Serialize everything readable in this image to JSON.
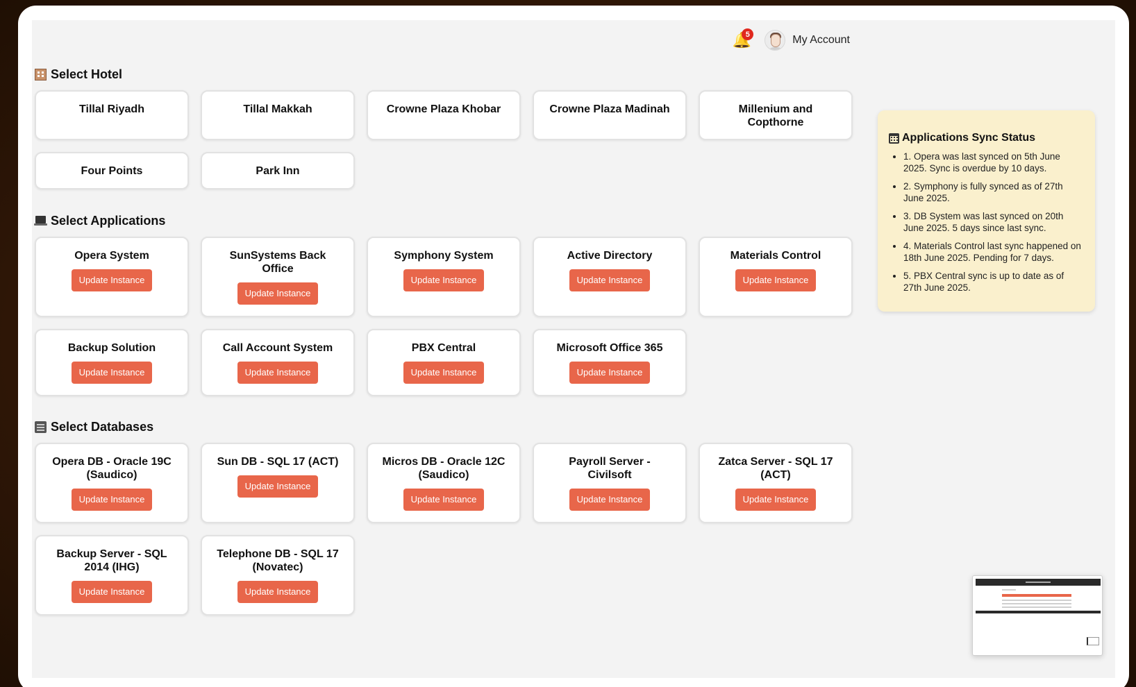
{
  "header": {
    "notifications_count": "5",
    "account_label": "My Account"
  },
  "sections": {
    "hotels": {
      "title": "Select Hotel",
      "items": [
        "Tillal Riyadh",
        "Tillal Makkah",
        "Crowne Plaza Khobar",
        "Crowne Plaza Madinah",
        "Millenium and Copthorne",
        "Four Points",
        "Park Inn"
      ]
    },
    "applications": {
      "title": "Select Applications",
      "button_label": "Update Instance",
      "items": [
        "Opera System",
        "SunSystems Back Office",
        "Symphony System",
        "Active Directory",
        "Materials Control",
        "Backup Solution",
        "Call Account System",
        "PBX Central",
        "Microsoft Office 365"
      ]
    },
    "databases": {
      "title": "Select Databases",
      "button_label": "Update Instance",
      "items": [
        "Opera DB - Oracle 19C (Saudico)",
        "Sun DB - SQL 17 (ACT)",
        "Micros DB - Oracle 12C (Saudico)",
        "Payroll Server - Civilsoft",
        "Zatca Server - SQL 17 (ACT)",
        "Backup Server - SQL 2014 (IHG)",
        "Telephone DB - SQL 17 (Novatec)"
      ]
    }
  },
  "sync_status": {
    "title": "Applications Sync Status",
    "items": [
      "1. Opera was last synced on 5th June 2025. Sync is overdue by 10 days.",
      "2. Symphony is fully synced as of 27th June 2025.",
      "3. DB System was last synced on 20th June 2025. 5 days since last sync.",
      "4. Materials Control last sync happened on 18th June 2025. Pending for 7 days.",
      "5. PBX Central sync is up to date as of 27th June 2025."
    ]
  },
  "icons": {
    "notifications": "bell-icon",
    "hotel_section": "hotel-icon",
    "applications_section": "laptop-icon",
    "databases_section": "file-cabinet-icon",
    "sync_status": "calendar-icon"
  },
  "colors": {
    "accent_button": "#e8664a",
    "badge": "#e0281e",
    "sync_panel_bg": "#faf0cd",
    "card_border": "#e2e2e2"
  }
}
